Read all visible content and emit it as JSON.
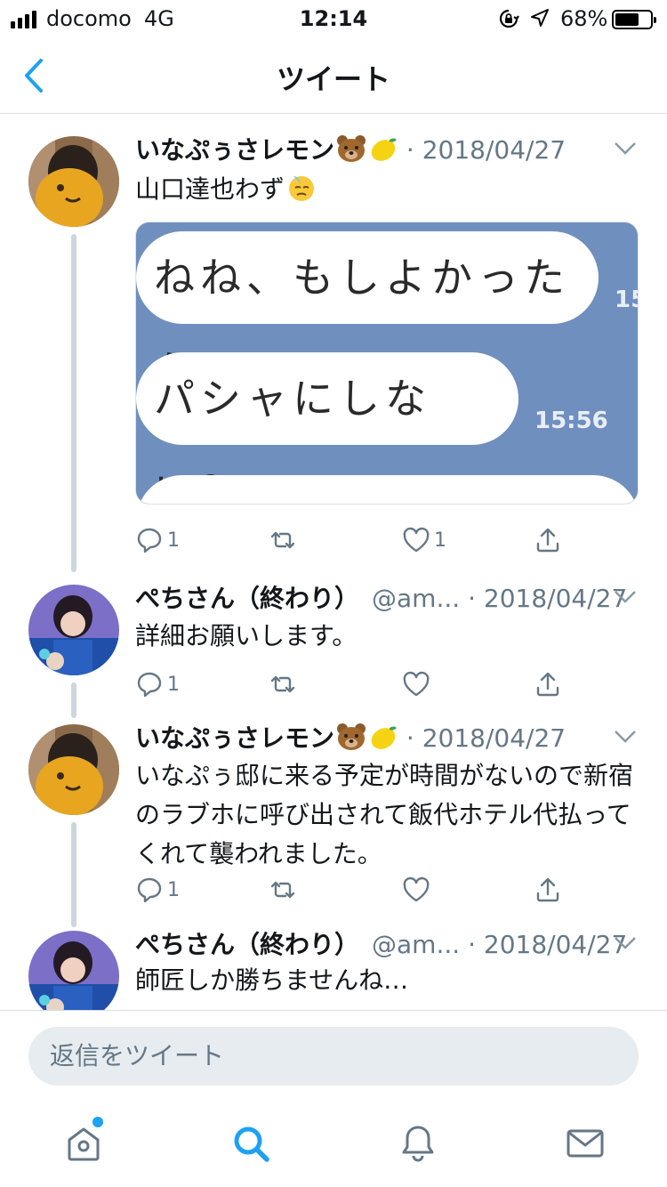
{
  "status_bar": {
    "carrier": "docomo",
    "network": "4G",
    "time": "12:14",
    "battery": "68%",
    "battery_level": 0.68
  },
  "nav": {
    "title": "ツイート",
    "back_icon": "chevron-left-icon"
  },
  "tweets": [
    {
      "name": "いなぷぅさレモン",
      "handle": "",
      "date": "2018/04/27",
      "text": "山口達也わず",
      "replies": "1",
      "retweets": "",
      "likes": "1",
      "media": {
        "line1": "ねね、もしよかったら",
        "line1_time": "15",
        "line2": "パシャにしない？",
        "line2_time": "15:56"
      }
    },
    {
      "name": "ぺちさん（終わり）",
      "handle": "@am...",
      "date": "2018/04/27",
      "text": "詳細お願いします。",
      "replies": "1",
      "retweets": "",
      "likes": ""
    },
    {
      "name": "いなぷぅさレモン",
      "handle": "",
      "date": "2018/04/27",
      "text": "いなぷぅ邸に来る予定が時間がないので新宿のラブホに呼び出されて飯代ホテル代払ってくれて襲われました。",
      "replies": "1",
      "retweets": "",
      "likes": ""
    },
    {
      "name": "ぺちさん（終わり）",
      "handle": "@am...",
      "date": "2018/04/27",
      "text": "師匠しか勝ちませんね…"
    }
  ],
  "separator": "·",
  "reply_bar": {
    "placeholder": "返信をツイート"
  },
  "tab_bar": {
    "items": [
      "home-icon",
      "search-icon",
      "notifications-icon",
      "messages-icon"
    ]
  },
  "colors": {
    "accent": "#1da1f2",
    "muted": "#657786"
  }
}
